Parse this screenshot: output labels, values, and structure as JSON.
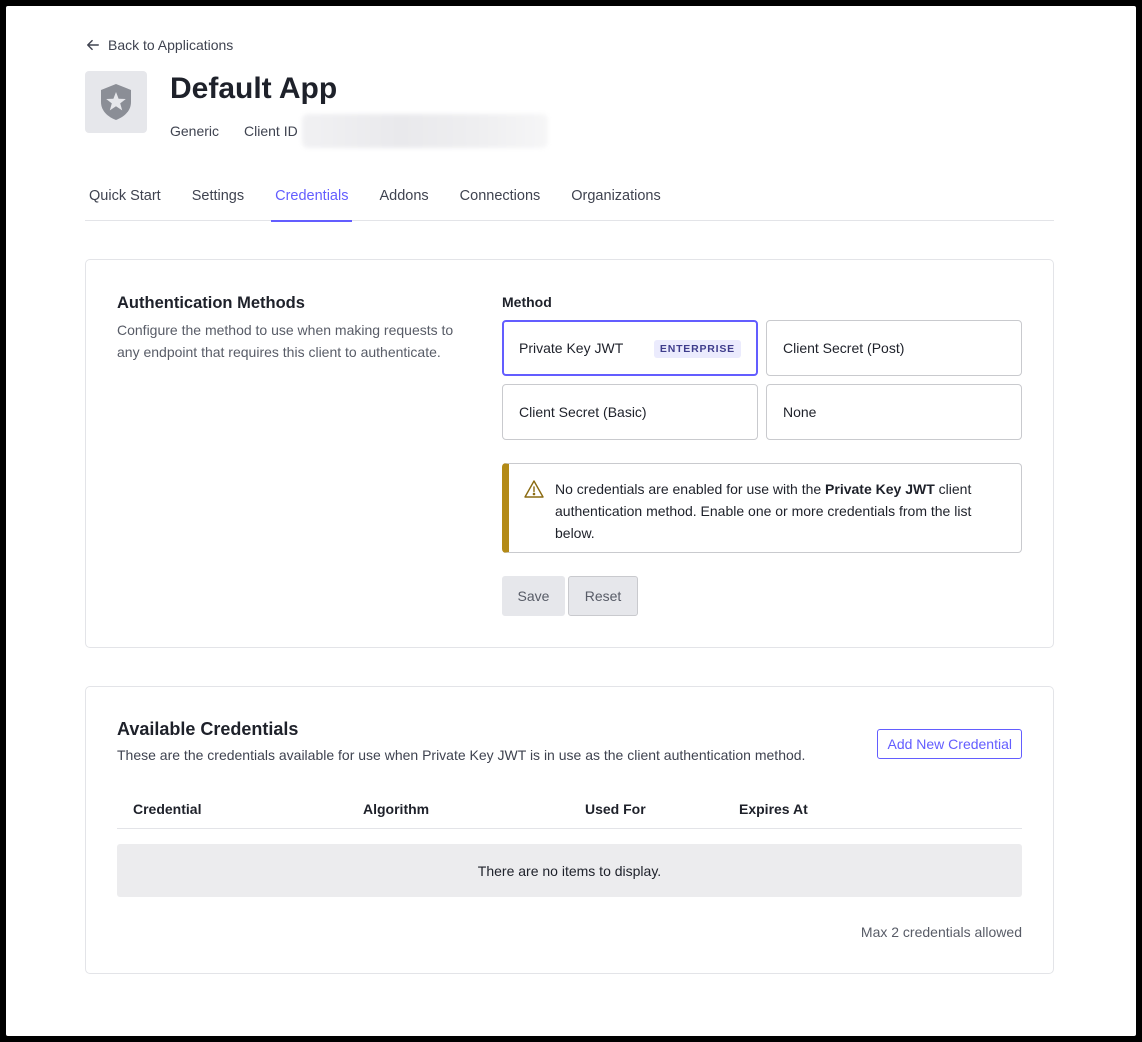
{
  "nav": {
    "back_label": "Back to Applications"
  },
  "app": {
    "title": "Default App",
    "type": "Generic",
    "client_id_label": "Client ID",
    "icon": "shield-star-icon"
  },
  "tabs": [
    {
      "label": "Quick Start"
    },
    {
      "label": "Settings"
    },
    {
      "label": "Credentials",
      "active": true
    },
    {
      "label": "Addons"
    },
    {
      "label": "Connections"
    },
    {
      "label": "Organizations"
    }
  ],
  "auth_methods": {
    "title": "Authentication Methods",
    "description": "Configure the method to use when making requests to any endpoint that requires this client to authenticate.",
    "method_label": "Method",
    "options": [
      {
        "label": "Private Key JWT",
        "badge": "ENTERPRISE",
        "selected": true
      },
      {
        "label": "Client Secret (Post)"
      },
      {
        "label": "Client Secret (Basic)"
      },
      {
        "label": "None"
      }
    ],
    "alert": {
      "icon": "warning-triangle-icon",
      "text_before": "No credentials are enabled for use with the ",
      "text_bold": "Private Key JWT",
      "text_after": " client authentication method. Enable one or more credentials from the list below."
    },
    "save_label": "Save",
    "reset_label": "Reset"
  },
  "credentials": {
    "title": "Available Credentials",
    "description": "These are the credentials available for use when Private Key JWT is in use as the client authentication method.",
    "add_label": "Add New Credential",
    "columns": [
      "Credential",
      "Algorithm",
      "Used For",
      "Expires At"
    ],
    "empty_text": "There are no items to display.",
    "max_note": "Max 2 credentials allowed"
  },
  "colors": {
    "accent": "#635dff",
    "warning": "#b38a16",
    "badge_bg": "#ebebfd"
  }
}
